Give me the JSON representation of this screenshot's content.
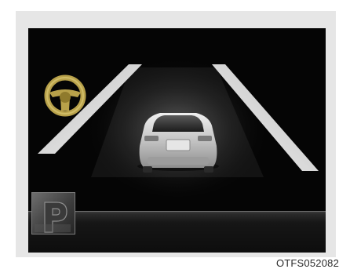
{
  "figure": {
    "caption": "OTFS052082",
    "icons": {
      "steering_wheel": "steering-wheel-icon",
      "parking_indicator": "parking-indicator-icon"
    },
    "colors": {
      "screen_bg": "#050505",
      "frame_bg": "#e6e6e6",
      "lane_line": "#e8e8e8",
      "wheel_gold": "#b8a14a"
    }
  }
}
